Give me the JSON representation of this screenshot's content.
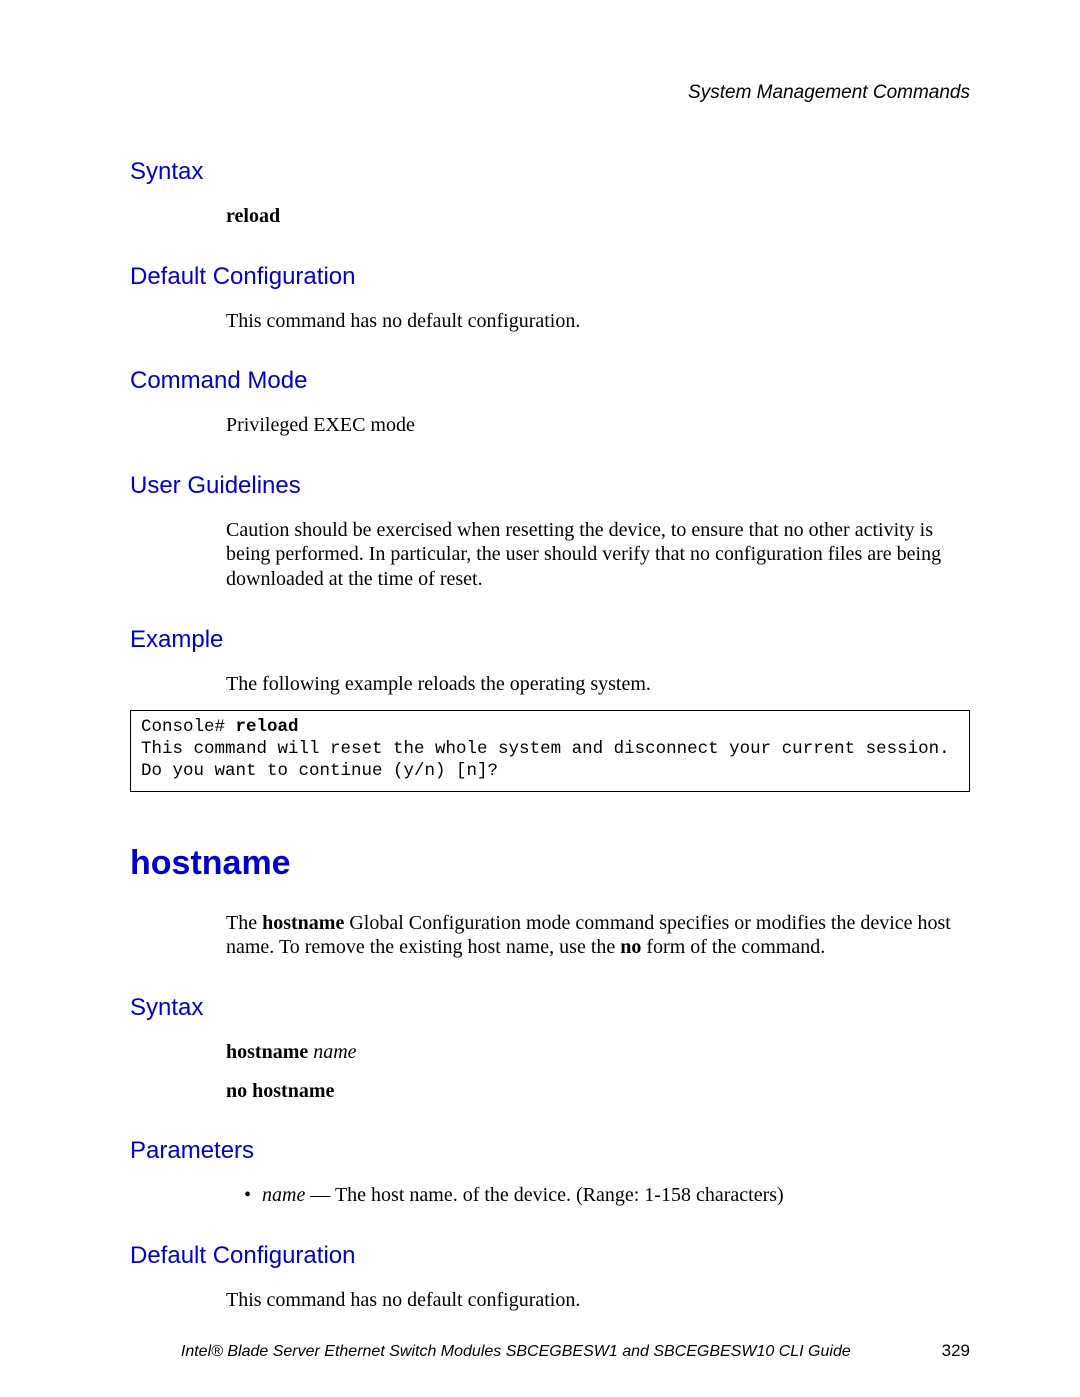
{
  "header": {
    "text": "System Management Commands"
  },
  "sections": {
    "syntax1": {
      "heading": "Syntax",
      "content": "reload"
    },
    "defcfg1": {
      "heading": "Default Configuration",
      "content": "This command has no default configuration."
    },
    "cmdmode": {
      "heading": "Command Mode",
      "content": "Privileged EXEC mode"
    },
    "userguide": {
      "heading": "User Guidelines",
      "content": "Caution should be exercised when resetting the device, to ensure that no other activity is being performed. In particular, the user should verify that no configuration files are being downloaded at the time of reset."
    },
    "example": {
      "heading": "Example",
      "intro": "The following example reloads the operating system."
    },
    "codebox": {
      "prompt": "Console# ",
      "cmd": "reload",
      "body": "This command will reset the whole system and disconnect your current session. Do you want to continue (y/n) [n]?"
    },
    "hostname": {
      "heading": "hostname",
      "intro_pre": "The ",
      "intro_b1": "hostname",
      "intro_mid": " Global Configuration mode command specifies or modifies the device host name. To remove the existing host name, use the ",
      "intro_b2": "no",
      "intro_post": " form of the command."
    },
    "syntax2": {
      "heading": "Syntax",
      "line1_b": "hostname ",
      "line1_i": "name",
      "line2": "no hostname"
    },
    "params": {
      "heading": "Parameters",
      "item_i": "name",
      "item_rest": " — The host name. of the device. (Range: 1-158 characters)"
    },
    "defcfg2": {
      "heading": "Default Configuration",
      "content": "This command has no default configuration."
    }
  },
  "footer": {
    "title": "Intel® Blade Server Ethernet Switch Modules SBCEGBESW1 and SBCEGBESW10 CLI Guide",
    "page": "329"
  }
}
